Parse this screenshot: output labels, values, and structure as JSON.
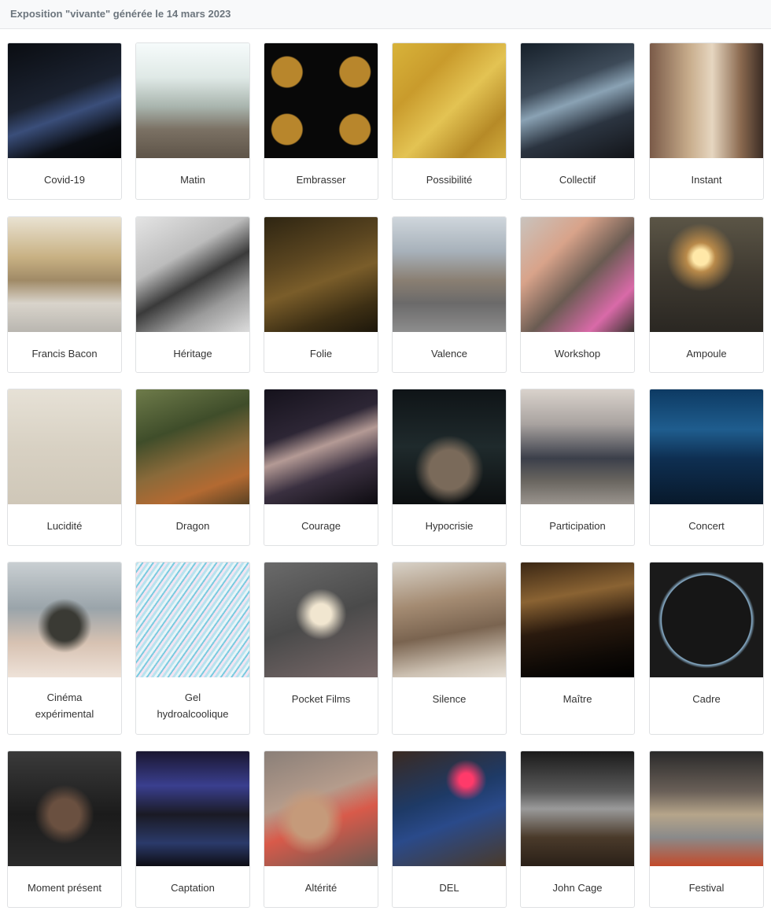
{
  "header": {
    "title": "Exposition \"vivante\" générée le 14 mars 2023"
  },
  "gallery": {
    "items": [
      {
        "label": "Covid-19",
        "bg": "linear-gradient(160deg,#0a0d12 0%,#1b2230 45%,#3a4e7a 60%,#0b0e14 80%,#050607 100%)"
      },
      {
        "label": "Matin",
        "bg": "linear-gradient(180deg,#f6fbfb 0%,#dfe9e6 30%,#a9b5ae 55%,#7b7164 75%,#5e5448 100%)"
      },
      {
        "label": "Embrasser",
        "bg": "radial-gradient(circle at 20% 25%,#b8862c 0 12%,transparent 13%),radial-gradient(circle at 80% 25%,#b8862c 0 12%,transparent 13%),radial-gradient(circle at 20% 75%,#b8862c 0 12%,transparent 13%),radial-gradient(circle at 80% 75%,#b8862c 0 12%,transparent 13%),#080808"
      },
      {
        "label": "Possibilité",
        "bg": "linear-gradient(135deg,#d8b33a 0%,#c99b2c 30%,#e3c353 55%,#b68a27 80%,#d2ad3d 100%)"
      },
      {
        "label": "Collectif",
        "bg": "linear-gradient(160deg,#16202a 0%,#3d4a58 35%,#8aa2b4 50%,#2b3440 70%,#121418 100%)"
      },
      {
        "label": "Instant",
        "bg": "linear-gradient(90deg,#7a5a48 0%,#c8ad8c 35%,#e6d6c0 55%,#8b6a50 80%,#3b2c24 100%)"
      },
      {
        "label": "Francis Bacon",
        "bg": "linear-gradient(180deg,#e9e2d2 0%,#c8b183 35%,#a08a66 55%,#d9d4cb 75%,#b9b6b0 100%)"
      },
      {
        "label": "Héritage",
        "bg": "linear-gradient(150deg,#e4e4e4 0%,#bcbcbc 35%,#3a3a3a 55%,#9a9a9a 75%,#dcdcdc 100%)"
      },
      {
        "label": "Folie",
        "bg": "linear-gradient(160deg,#2e2512 0%,#5a4520 35%,#7a5d2a 55%,#3d2f14 80%,#1d170b 100%)"
      },
      {
        "label": "Valence",
        "bg": "linear-gradient(180deg,#cfd6dc 0%,#a7b1ba 30%,#8a7f72 55%,#6b6a6a 75%,#8d8d8d 100%)"
      },
      {
        "label": "Workshop",
        "bg": "linear-gradient(135deg,#c9c3bd 0%,#d8a38a 30%,#6a5b52 55%,#d96aa8 80%,#3a3330 100%)"
      },
      {
        "label": "Ampoule",
        "bg": "radial-gradient(circle at 45% 35%,#ffe8a8 0 8%,#b98a4a 15%,transparent 35%),linear-gradient(180deg,#5b5546 0%,#3f3a31 50%,#2a2722 100%)"
      },
      {
        "label": "Lucidité",
        "bg": "linear-gradient(180deg,#e6e1d6 0%,#d8d1c3 50%,#cfc7b8 100%)"
      },
      {
        "label": "Dragon",
        "bg": "linear-gradient(160deg,#6e7b4a 0%,#3f4d2a 35%,#8a6a3a 60%,#b36a32 80%,#5a4122 100%)"
      },
      {
        "label": "Courage",
        "bg": "linear-gradient(160deg,#15121c 0%,#2d2635 35%,#b49a95 50%,#3a3040 70%,#0d0b10 100%)"
      },
      {
        "label": "Hypocrisie",
        "bg": "radial-gradient(circle at 50% 70%,#7a6a5a 0 20%,transparent 35%),linear-gradient(180deg,#0f1417 0%,#1f2a2c 50%,#0c0f10 100%)"
      },
      {
        "label": "Participation",
        "bg": "linear-gradient(180deg,#d9d2cc 0%,#a9a3a0 30%,#3b3f4a 60%,#6a6660 80%,#9a948e 100%)"
      },
      {
        "label": "Concert",
        "bg": "linear-gradient(180deg,#0d3a63 0%,#1f5d8e 35%,#0e2f52 60%,#08192b 100%)"
      },
      {
        "label": "Cinéma\nexpérimental",
        "bg": "radial-gradient(circle at 50% 55%,#3a3a34 0 18%,transparent 32%),linear-gradient(180deg,#c9cfd2 0%,#9aa4aa 40%,#d7c2b2 70%,#eee2d8 100%)"
      },
      {
        "label": "Gel\nhydroalcoolique",
        "bg": "repeating-linear-gradient(125deg,#b9e3ef 0 3px,#e9f5f8 3px 6px,#7ccbe0 6px 8px,#f3e4f1 8px 11px)"
      },
      {
        "label": "Pocket Films",
        "bg": "radial-gradient(circle at 50% 45%,#f1e6d0 0 12%,transparent 30%),linear-gradient(160deg,#6a6a6a 0%,#4a4a4a 50%,#7a6a6a 100%)"
      },
      {
        "label": "Silence",
        "bg": "linear-gradient(170deg,#d8d2c8 0%,#a48b72 35%,#7a6450 60%,#cbbfb0 85%,#e6dfd5 100%)"
      },
      {
        "label": "Maître",
        "bg": "linear-gradient(170deg,#3b2714 0%,#8a6333 30%,#2a1a0e 55%,#0f0a06 80%,#000 100%)"
      },
      {
        "label": "Cadre",
        "bg": "radial-gradient(circle at 50% 50%,#161616 0 55%,#8ab0cc 56%,#1a1a1a 60%)"
      },
      {
        "label": "Moment présent",
        "bg": "radial-gradient(circle at 50% 55%,#6a5040 0 18%,transparent 35%),linear-gradient(180deg,#3a3a3a 0%,#1b1b1b 55%,#2a2a2a 100%)"
      },
      {
        "label": "Captation",
        "bg": "linear-gradient(180deg,#1a1630 0%,#3a3f8f 30%,#1a1a24 55%,#2b3a6a 80%,#0d0d14 100%)"
      },
      {
        "label": "Altérité",
        "bg": "radial-gradient(circle at 40% 60%,#c59a7a 0 18%,transparent 35%),linear-gradient(160deg,#8a7f78 0%,#b59c8c 40%,#d85a4a 60%,#6a5a52 100%)"
      },
      {
        "label": "DEL",
        "bg": "radial-gradient(circle at 65% 25%,#ff3a6a 0 6%,transparent 18%),linear-gradient(160deg,#3a2a22 0%,#1e3a66 40%,#2a4a8a 60%,#4a3a2a 100%)"
      },
      {
        "label": "John Cage",
        "bg": "linear-gradient(180deg,#1a1a1a 0%,#5a5a5a 35%,#9a9a9a 50%,#4a3a2a 75%,#2a2018 100%)"
      },
      {
        "label": "Festival",
        "bg": "linear-gradient(180deg,#2a2a2a 0%,#6a6058 35%,#b6a58a 55%,#8a8a8a 75%,#c34a2a 100%)"
      }
    ]
  }
}
